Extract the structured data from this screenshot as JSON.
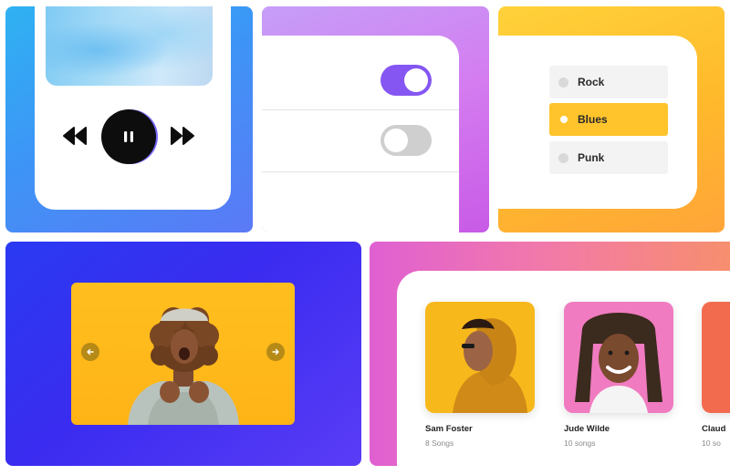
{
  "player": {
    "controls": {
      "rewind_icon": "rewind-icon",
      "pause_icon": "pause-icon",
      "forward_icon": "fast-forward-icon"
    }
  },
  "toggles": {
    "items": [
      {
        "state": "on",
        "color": "#8556f2"
      },
      {
        "state": "off",
        "color": "#cfcfcf"
      }
    ]
  },
  "genres": {
    "options": [
      {
        "label": "Rock",
        "selected": false
      },
      {
        "label": "Blues",
        "selected": true
      },
      {
        "label": "Punk",
        "selected": false
      }
    ],
    "accent": "#ffc42c"
  },
  "carousel": {
    "prev_icon": "arrow-left-icon",
    "next_icon": "arrow-right-icon"
  },
  "artists": {
    "items": [
      {
        "name": "Sam Foster",
        "songs": "8 Songs"
      },
      {
        "name": "Jude Wilde",
        "songs": "10 songs"
      },
      {
        "name": "Claud",
        "songs": "10 so"
      }
    ]
  }
}
